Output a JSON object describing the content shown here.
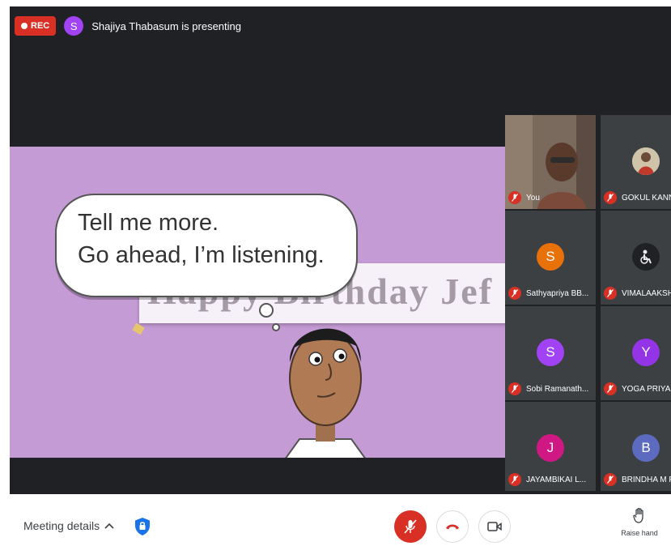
{
  "recording": {
    "label": "REC"
  },
  "presenter": {
    "initial": "S",
    "text": "Shajiya Thabasum is presenting"
  },
  "slide": {
    "bubble_lines": [
      "Tell me more.",
      "Go ahead, I’m listening."
    ],
    "banner_text": "Happy Birthday Jef"
  },
  "participants": [
    {
      "name": "You",
      "initial": "",
      "avatar_color": "",
      "muted": true
    },
    {
      "name": "GOKUL KANNA",
      "initial": "",
      "avatar_color": "",
      "muted": true
    },
    {
      "name": "Sathyapriya BB...",
      "initial": "S",
      "avatar_color": "#e8710a",
      "muted": true
    },
    {
      "name": "VIMALAAKSH",
      "initial": "",
      "avatar_color": "#202124",
      "muted": true
    },
    {
      "name": "Sobi Ramanath...",
      "initial": "S",
      "avatar_color": "#a142f4",
      "muted": true
    },
    {
      "name": "YOGA PRIYA B",
      "initial": "Y",
      "avatar_color": "#9334e6",
      "muted": true
    },
    {
      "name": "JAYAMBIKAI L...",
      "initial": "J",
      "avatar_color": "#d01884",
      "muted": true
    },
    {
      "name": "BRINDHA M P",
      "initial": "B",
      "avatar_color": "#5c6bc0",
      "muted": true
    }
  ],
  "bottom_bar": {
    "meeting_details_label": "Meeting details",
    "raise_hand_label": "Raise hand"
  },
  "colors": {
    "end_call": "#d93025",
    "rec": "#d93025",
    "slide_bg": "#c49bd4"
  },
  "icons": [
    "rec-dot-icon",
    "chevron-up-icon",
    "shield-icon",
    "mic-off-icon",
    "hang-up-icon",
    "camera-icon",
    "raise-hand-icon"
  ]
}
